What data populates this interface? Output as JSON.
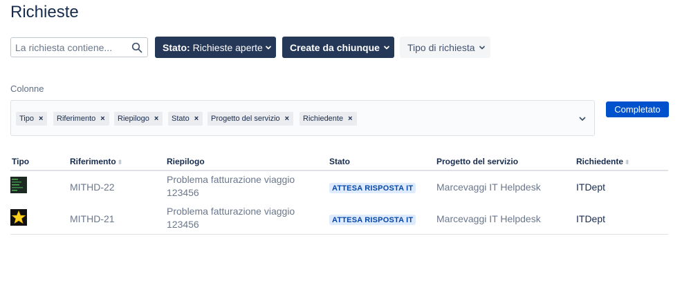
{
  "page": {
    "title": "Richieste"
  },
  "filters": {
    "search_placeholder": "La richiesta contiene...",
    "stato_prefix": "Stato:",
    "stato_value": "Richieste aperte",
    "create_label": "Create da chiunque",
    "tipo_label": "Tipo di richiesta"
  },
  "columns_section": {
    "label": "Colonne",
    "chips": [
      "Tipo",
      "Riferimento",
      "Riepilogo",
      "Stato",
      "Progetto del servizio",
      "Richiedente"
    ],
    "remove_glyph": "×",
    "done_label": "Completato"
  },
  "table": {
    "headers": [
      "Tipo",
      "Riferimento",
      "Riepilogo",
      "Stato",
      "Progetto del servizio",
      "Richiedente"
    ],
    "rows": [
      {
        "type_icon": "terminal-icon",
        "riferimento": "MITHD-22",
        "riepilogo_line1": "Problema fatturazione viaggio",
        "riepilogo_line2": "123456",
        "stato": "ATTESA RISPOSTA IT",
        "progetto": "Marcevaggi IT Helpdesk",
        "richiedente": "ITDept"
      },
      {
        "type_icon": "star-icon",
        "riferimento": "MITHD-21",
        "riepilogo_line1": "Problema fatturazione viaggio",
        "riepilogo_line2": "123456",
        "stato": "ATTESA RISPOSTA IT",
        "progetto": "Marcevaggi IT Helpdesk",
        "richiedente": "ITDept"
      }
    ]
  },
  "colors": {
    "primary_dark": "#253858",
    "accent_blue": "#0052cc",
    "badge_bg": "#deebff",
    "badge_text": "#0747a6"
  }
}
